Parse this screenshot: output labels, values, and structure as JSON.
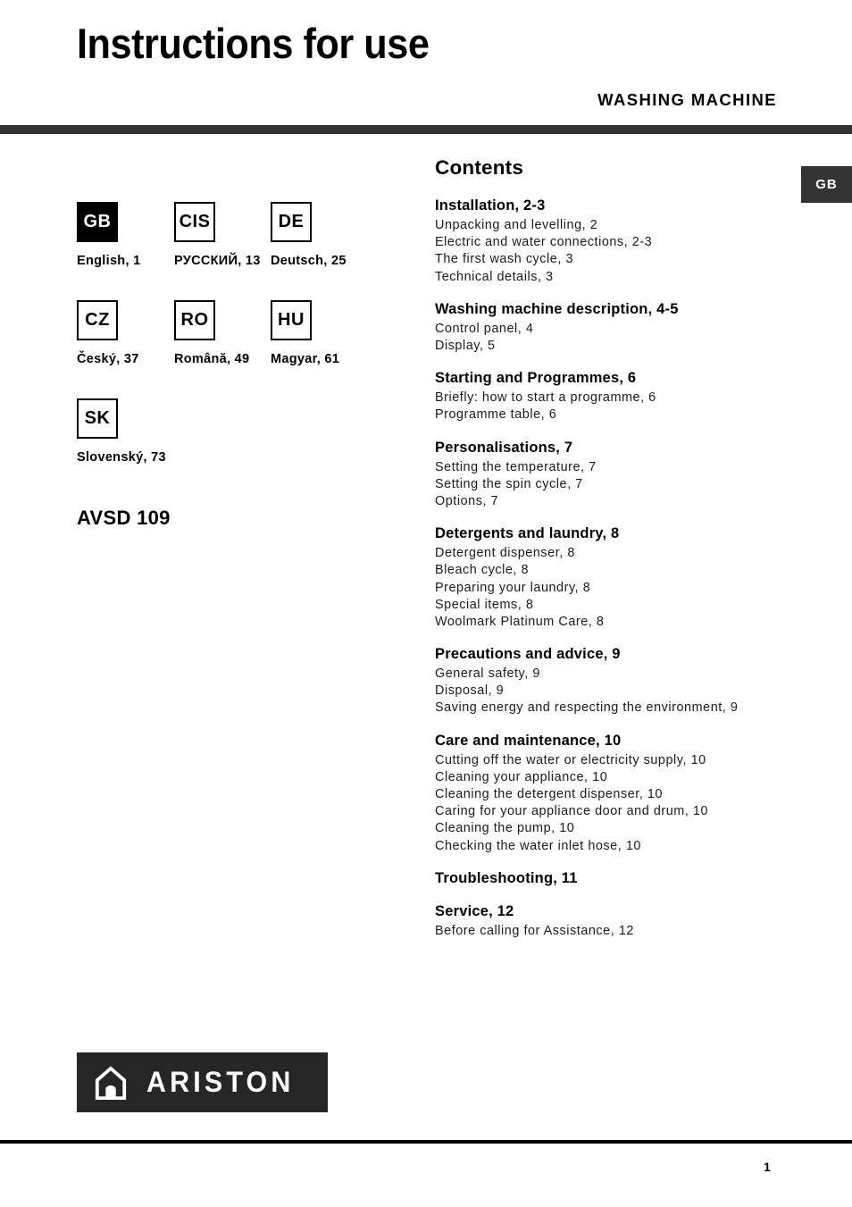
{
  "header": {
    "title": "Instructions for use",
    "product_type": "WASHING  MACHINE"
  },
  "side_tab": {
    "label": "GB"
  },
  "languages": [
    [
      {
        "code": "GB",
        "label": "English, 1",
        "selected": true
      },
      {
        "code": "CIS",
        "label": "РУССКИЙ, 13",
        "selected": false
      },
      {
        "code": "DE",
        "label": "Deutsch, 25",
        "selected": false
      }
    ],
    [
      {
        "code": "CZ",
        "label": "Český, 37",
        "selected": false
      },
      {
        "code": "RO",
        "label": "Română, 49",
        "selected": false
      },
      {
        "code": "HU",
        "label": "Magyar, 61",
        "selected": false
      }
    ],
    [
      {
        "code": "SK",
        "label": "Slovenský, 73",
        "selected": false
      }
    ]
  ],
  "model": {
    "name": "AVSD 109"
  },
  "contents": {
    "title": "Contents",
    "sections": [
      {
        "heading": "Installation, 2-3",
        "items": [
          "Unpacking and levelling, 2",
          "Electric and water connections, 2-3",
          "The first wash cycle, 3",
          "Technical details, 3"
        ]
      },
      {
        "heading": "Washing machine description, 4-5",
        "items": [
          "Control panel, 4",
          "Display, 5"
        ]
      },
      {
        "heading": "Starting and Programmes, 6",
        "items": [
          "Briefly: how to start a programme, 6",
          "Programme table, 6"
        ]
      },
      {
        "heading": "Personalisations, 7",
        "items": [
          "Setting the temperature, 7",
          "Setting the spin cycle, 7",
          "Options, 7"
        ]
      },
      {
        "heading": "Detergents and laundry, 8",
        "items": [
          "Detergent dispenser, 8",
          "Bleach cycle, 8",
          "Preparing your laundry, 8",
          "Special items, 8",
          "Woolmark Platinum Care, 8"
        ]
      },
      {
        "heading": "Precautions and advice, 9",
        "items": [
          "General safety, 9",
          "Disposal, 9",
          "Saving energy and respecting the environment, 9"
        ]
      },
      {
        "heading": "Care and maintenance, 10",
        "items": [
          "Cutting off the water or electricity supply, 10",
          "Cleaning your appliance, 10",
          "Cleaning the detergent dispenser, 10",
          "Caring for your appliance door and drum, 10",
          "Cleaning the pump, 10",
          "Checking the water inlet hose, 10"
        ]
      },
      {
        "heading": "Troubleshooting, 11",
        "items": []
      },
      {
        "heading": "Service, 12",
        "items": [
          "Before calling for Assistance, 12"
        ]
      }
    ]
  },
  "brand": {
    "wordmark": "ARISTON"
  },
  "footer": {
    "page_number": "1"
  },
  "colors": {
    "bar": "#333333",
    "logo_bg": "#262626",
    "text": "#000000"
  }
}
